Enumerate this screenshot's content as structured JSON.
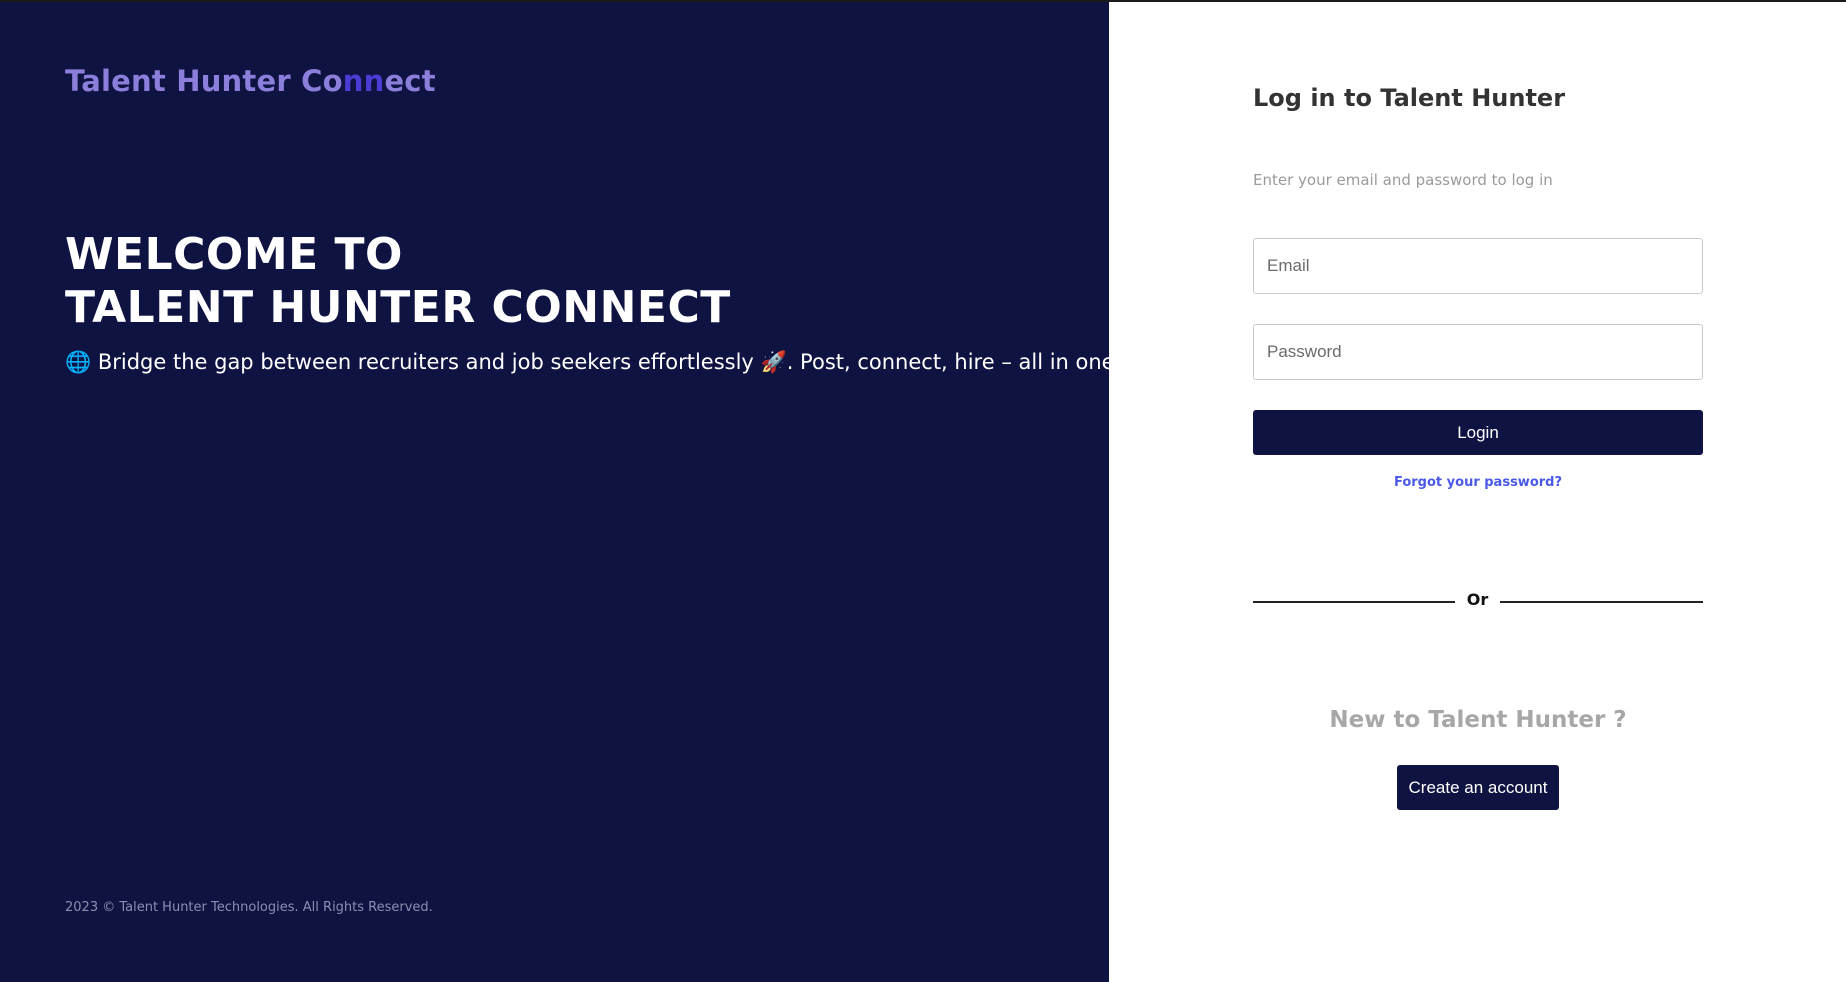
{
  "brand": {
    "part1": "Talent Hunter Co",
    "part2": "nn",
    "part3": "ect",
    "colors": {
      "main": "#8c7fdc",
      "highlight": "#4a3dd6"
    }
  },
  "hero": {
    "headline_line1": "WELCOME TO",
    "headline_line2": "TALENT HUNTER CONNECT",
    "tagline_icon": "🌐",
    "tagline_text1": "Bridge the gap between recruiters and job seekers effortlessly",
    "tagline_icon2": "🚀",
    "tagline_text2": ". Post, connect, hire – all in one place"
  },
  "footer": {
    "text": "2023 © Talent Hunter Technologies. All Rights Reserved."
  },
  "login": {
    "title": "Log in to Talent Hunter",
    "subtitle": "Enter your email and password to log in",
    "email_placeholder": "Email",
    "password_placeholder": "Password",
    "login_label": "Login",
    "forgot_label": "Forgot your password?",
    "divider_label": "Or",
    "new_title": "New to Talent Hunter ?",
    "create_label": "Create an account"
  },
  "colors": {
    "panel_bg": "#0f1342",
    "link": "#4a5ae6"
  }
}
